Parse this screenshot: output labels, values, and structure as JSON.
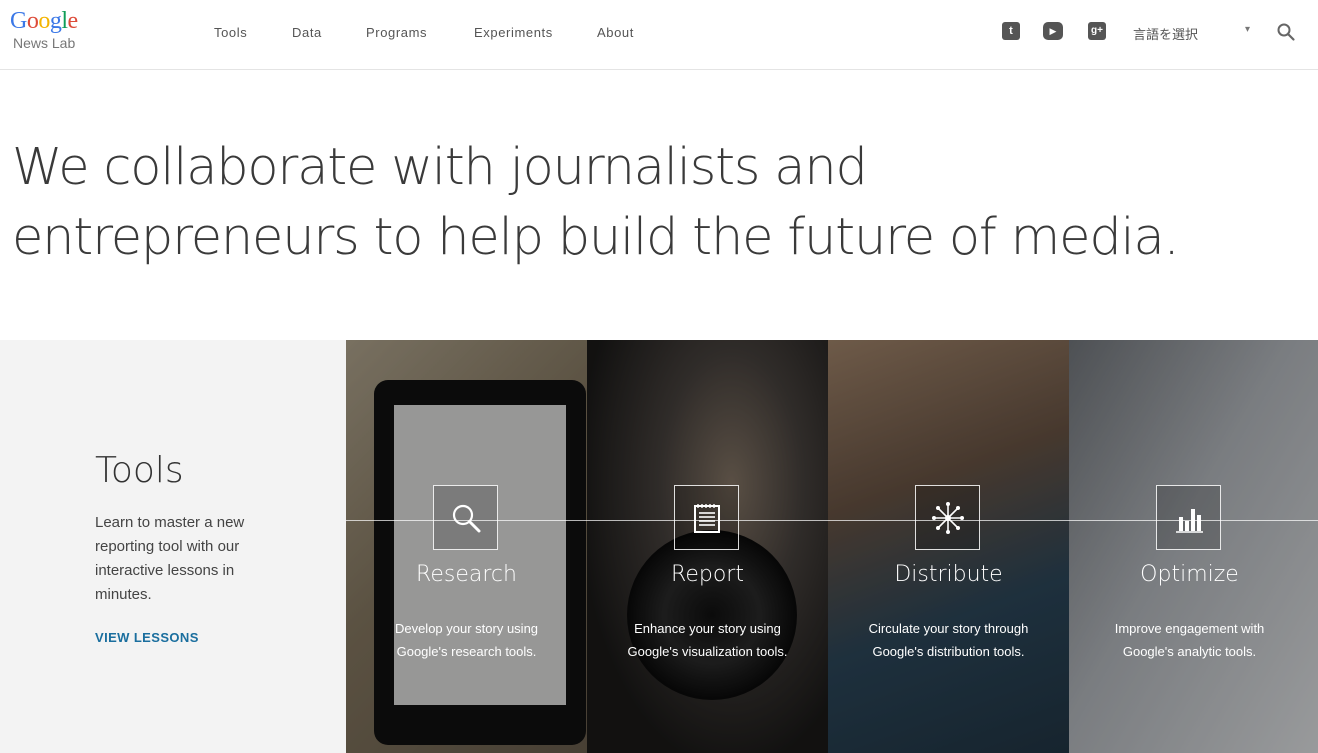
{
  "brand": {
    "logo_letters": [
      {
        "ch": "G",
        "color": "#3b78e7"
      },
      {
        "ch": "o",
        "color": "#dd4b39"
      },
      {
        "ch": "o",
        "color": "#f4b400"
      },
      {
        "ch": "g",
        "color": "#3b78e7"
      },
      {
        "ch": "l",
        "color": "#0f9d58"
      },
      {
        "ch": "e",
        "color": "#dd4b39"
      }
    ],
    "sub": "News Lab"
  },
  "nav": [
    "Tools",
    "Data",
    "Programs",
    "Experiments",
    "About"
  ],
  "social": [
    {
      "name": "twitter-icon",
      "glyph": "t"
    },
    {
      "name": "youtube-icon",
      "glyph": "▶"
    },
    {
      "name": "google-plus-icon",
      "glyph": "g+"
    }
  ],
  "language": {
    "label": "言語を選択",
    "caret": "▾"
  },
  "search_icon": "search-icon",
  "hero": {
    "line1": "We collaborate with journalists and",
    "line2": "entrepreneurs to help build the future of media."
  },
  "tools": {
    "title": "Tools",
    "description": "Learn to master a new reporting tool with our interactive lessons in minutes.",
    "link": "VIEW LESSONS"
  },
  "tiles": [
    {
      "title": "Research",
      "icon": "magnifier-icon",
      "desc1": "Develop your story using",
      "desc2": "Google's research tools.",
      "bg": "#7a6f5c"
    },
    {
      "title": "Report",
      "icon": "notepad-icon",
      "desc1": "Enhance your story using",
      "desc2": "Google's visualization tools.",
      "bg": "#2b2a28"
    },
    {
      "title": "Distribute",
      "icon": "network-icon",
      "desc1": "Circulate your story through",
      "desc2": "Google's distribution tools.",
      "bg": "#2d4758"
    },
    {
      "title": "Optimize",
      "icon": "bar-chart-icon",
      "desc1": "Improve engagement with",
      "desc2": "Google's analytic tools.",
      "bg": "#9aa0a6"
    }
  ]
}
